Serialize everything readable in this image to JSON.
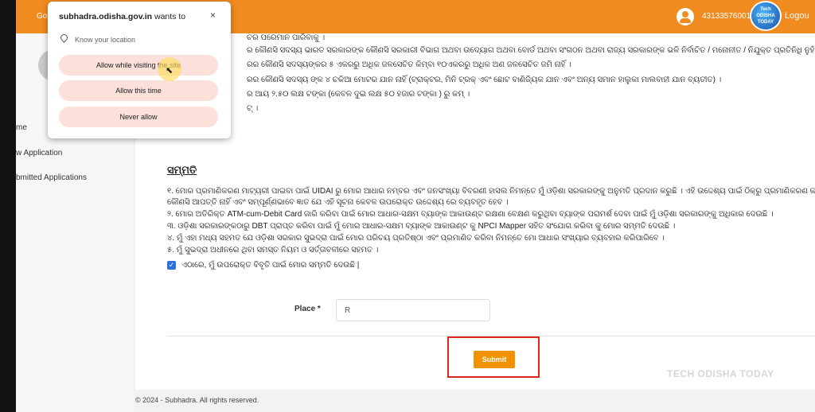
{
  "header": {
    "gov_text": "Gov",
    "user_id": "43133576001",
    "logout": "Logou",
    "logo_text": "Tech ODISHA TODAY"
  },
  "sidebar": {
    "items": [
      {
        "label": "me"
      },
      {
        "label": "w Application"
      },
      {
        "label": "bmitted Applications"
      }
    ]
  },
  "content": {
    "lines_top": [
      "ଚର ପରେମାନ ପାରିବାକୁ ।",
      "ର କୌଣସି ସଦସ୍ୟ ଭାରତ ସରକାରଙ୍କ କୌଣସି ସରକାରୀ ବିଭାଗ ଅଥବା ଉଦ୍ୟୋଗ ଅଥବା ବୋର୍ଡ ଅଥବା ସଂଗଠନ ଅଥବା ରାଜ୍ୟ ସରକାରଙ୍କ ଭଳି ନିର୍ବାଚିତ / ମନୋନୀତ / ନିଯୁକ୍ତ ପ୍ରତିନିଧି ନୁହଁନ୍ତି ।",
      "ରର କୌଣସି ସଦସ୍ୟଙ୍କର ୫ ଏକରରୁ ଅଧିକ ଜଳସେଚିତ କିମ୍ବା ୧୦ଏକରରୁ ଅଧିକ ଅଣ ଜଳସେଚିତ ଜମି ନାହିଁ ।",
      "ରର କୌଣସି ସଦସ୍ୟ ଙ୍କ ୪ ଚକିଆ ମୋଟର ଯାନ ନାହିଁ (ଟ୍ରାକ୍ଟର, ମିନି ଟ୍ରକ୍ ଏବଂ ଛୋଟ ବାଣିଜ୍ୟିକ ଯାନ ଏବଂ ଅନ୍ୟ ସମାନ ହାଲୁକା ମାଲବାହୀ ଯାନ ବ୍ୟତୀତ) ।",
      "ର ଆୟ ୨.୫୦ ଲକ୍ଷ ଟଙ୍କା (କେବଳ ଦୁଇ ଲକ୍ଷ ୫୦ ହଜାର ଟଙ୍କା ) ରୁ କମ୍ ।",
      "ଟ୍ ।"
    ],
    "consent_title": "ସମ୍ମତି",
    "consent_lines": [
      "୧. ମୋର ପ୍ରମାଣିକରଣ ମାଟ୍ୟରୀ ପାଇବା ପାଇଁ UIDAI ରୁ ମୋର ଆଧାର ନମ୍ବର ଏବଂ ଜନସଂଖ୍ୟା ବିବରଣୀ ହାସଲ ନିମନ୍ତେ ମୁଁ ଓଡ଼ିଶା ସରକାରଙ୍କୁ ଅନୁମତି ପ୍ରଦାନ କରୁଛି । ଏହି ଉଦ୍ଦେଶ୍ୟ ପାଇଁ ଠିକ୍ରୁ ପ୍ରମାଣିକରଣ କରିବାରେ ମୋର",
      "କୌଣସି ଆପତ୍ତି ନାହିଁ ଏବଂ ସମ୍ପୂର୍ଣ୍ଣଭାବେ ଜ୍ଞାତ ଯେ ଏହି ସୂଚନା କେବଳ ଉପରୋକ୍ତ ଉଦ୍ଦେଶ୍ୟ ରେ ବ୍ୟବହୃତ ହେବ ।",
      "୨. ମୋର ଅତିରିକ୍ତ ATM-cum-Debit Card ଜାରି କରିବା ପାଇଁ ମୋର ଆଧାର-ସକ୍ଷମ ବ୍ୟାଙ୍କ ଆକାଉଣ୍ଟ ରକ୍ଷଣା ବେକ୍ଷଣ କରୁଥିବା ବ୍ୟାଙ୍କ ପରାମର୍ଶ ଦେବା ପାଇଁ ମୁଁ ଓଡ଼ିଶା ସରକାରଙ୍କୁ ଅଧିକାର ଦେଉଛି ।",
      "୩. ଓଡ଼ିଶା ସରକାରଙ୍କଠାରୁ DBT ପ୍ରାପ୍ତ କରିବା ପାଇଁ ମୁଁ ମୋର ଆଧାର-ସକ୍ଷମ ବ୍ୟାଙ୍କ ଆକାଉଣ୍ଟ କୁ NPCI Mapper ସହିତ ସଂଯୋଗ କରିବା କୁ ମୋର ସମ୍ମତି ଦେଉଛି ।",
      "୪. ମୁଁ ଏହା ମଧ୍ୟ ସହମତ ଯେ ଓଡ଼ିଶା ସରକାର ସୁଭଦ୍ରା ପାଇଁ ମୋର ପରିଚୟ ପ୍ରତିଷ୍ଠା ଏବଂ ପ୍ରମାଣିତ କରିବା ନିମନ୍ତେ ମୋ ଆଧାର ସଂଖ୍ୟାର ବ୍ୟବହାର କରିପାରିବେ ।",
      "୫. ମୁଁ ସୁଭଦ୍ରା ଅଧୀନରେ ଥିବା ସମସ୍ତ ନିୟମ ଓ ସର୍ତ୍ତାବଳୀରେ ସହମତ ।"
    ],
    "agree_text": "ଏଠାରେ, ମୁଁ ଉପରୋକ୍ତ ବିବୃତି ପାଇଁ ମୋର ସମ୍ମତି ଦେଉଛି |",
    "place_label": "Place *",
    "place_value": "R",
    "submit_label": "Submit",
    "watermark": "TECH ODISHA TODAY"
  },
  "footer": {
    "text": "© 2024 - Subhadra. All rights reserved."
  },
  "popup": {
    "site": "subhadra.odisha.gov.in",
    "wants_to": " wants to",
    "close": "×",
    "location_text": "Know your location",
    "buttons": [
      "Allow while visiting the site",
      "Allow this time",
      "Never allow"
    ]
  }
}
